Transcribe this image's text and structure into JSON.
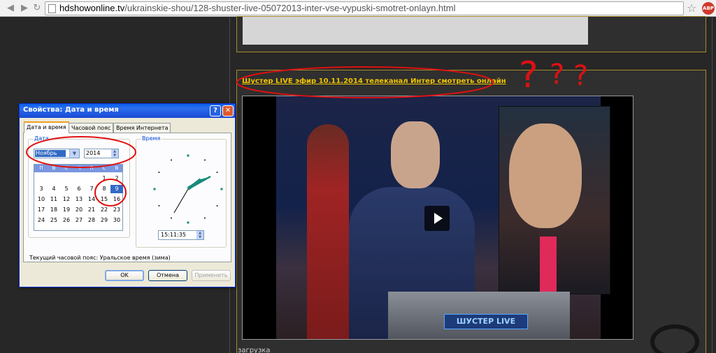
{
  "browser": {
    "url_host": "hdshowonline.tv",
    "url_path": "/ukrainskie-shou/128-shuster-live-05072013-inter-vse-vypuski-smotret-onlayn.html",
    "back_icon": "back-arrow-icon",
    "forward_icon": "forward-arrow-icon",
    "bookmark_icon": "star-icon",
    "extension_label": "ABP"
  },
  "page": {
    "video_title": "Шустер LIVE эфир 10.11.2014 телеканал Интер смотреть онлайн",
    "video_logo": "ШУСТЕР LIVE",
    "loading_text": "загрузка",
    "accent_color": "#f0c400"
  },
  "dialog": {
    "title": "Свойства: Дата и время",
    "help_label": "?",
    "close_label": "✕",
    "tabs": [
      {
        "label": "Дата и время",
        "active": true
      },
      {
        "label": "Часовой пояс",
        "active": false
      },
      {
        "label": "Время Интернета",
        "active": false
      }
    ],
    "date_group_label": "Дата",
    "time_group_label": "Время",
    "month": "Ноябрь",
    "year": "2014",
    "weekdays": [
      "П",
      "В",
      "С",
      "Ч",
      "П",
      "С",
      "В"
    ],
    "calendar_rows": [
      [
        "",
        "",
        "",
        "",
        "",
        "1",
        "2"
      ],
      [
        "3",
        "4",
        "5",
        "6",
        "7",
        "8",
        "9"
      ],
      [
        "10",
        "11",
        "12",
        "13",
        "14",
        "15",
        "16"
      ],
      [
        "17",
        "18",
        "19",
        "20",
        "21",
        "22",
        "23"
      ],
      [
        "24",
        "25",
        "26",
        "27",
        "28",
        "29",
        "30"
      ]
    ],
    "selected_day": "9",
    "time": "15:11:35",
    "timezone_text": "Текущий часовой пояс: Уральское время (зима)",
    "buttons": {
      "ok": "OK",
      "cancel": "Отмена",
      "apply": "Применить"
    }
  },
  "annotations": {
    "question_marks": [
      "?",
      "?",
      "?"
    ],
    "color": "#e01010"
  }
}
